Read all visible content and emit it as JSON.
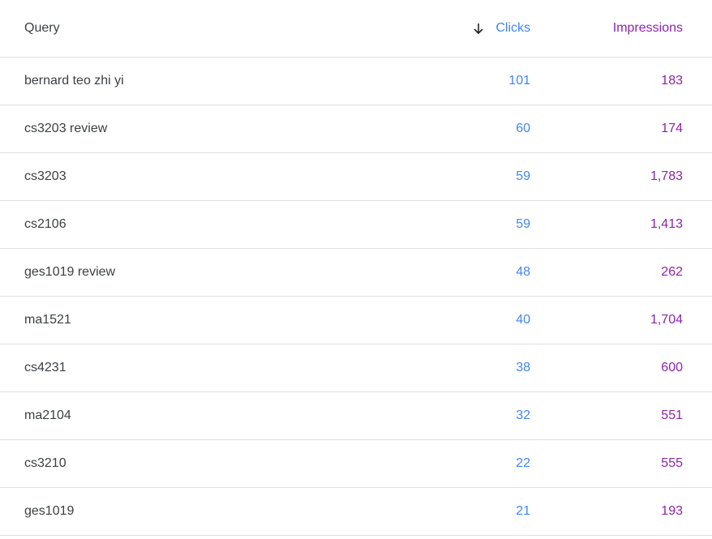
{
  "table": {
    "columns": {
      "query": "Query",
      "clicks": "Clicks",
      "impressions": "Impressions"
    },
    "sort": {
      "column": "clicks",
      "direction": "descending",
      "icon": "arrow-down-icon"
    },
    "colors": {
      "clicks": "#4285f4",
      "impressions": "#8e24aa"
    },
    "rows": [
      {
        "query": "bernard teo zhi yi",
        "clicks": "101",
        "impressions": "183"
      },
      {
        "query": "cs3203 review",
        "clicks": "60",
        "impressions": "174"
      },
      {
        "query": "cs3203",
        "clicks": "59",
        "impressions": "1,783"
      },
      {
        "query": "cs2106",
        "clicks": "59",
        "impressions": "1,413"
      },
      {
        "query": "ges1019 review",
        "clicks": "48",
        "impressions": "262"
      },
      {
        "query": "ma1521",
        "clicks": "40",
        "impressions": "1,704"
      },
      {
        "query": "cs4231",
        "clicks": "38",
        "impressions": "600"
      },
      {
        "query": "ma2104",
        "clicks": "32",
        "impressions": "551"
      },
      {
        "query": "cs3210",
        "clicks": "22",
        "impressions": "555"
      },
      {
        "query": "ges1019",
        "clicks": "21",
        "impressions": "193"
      }
    ]
  }
}
